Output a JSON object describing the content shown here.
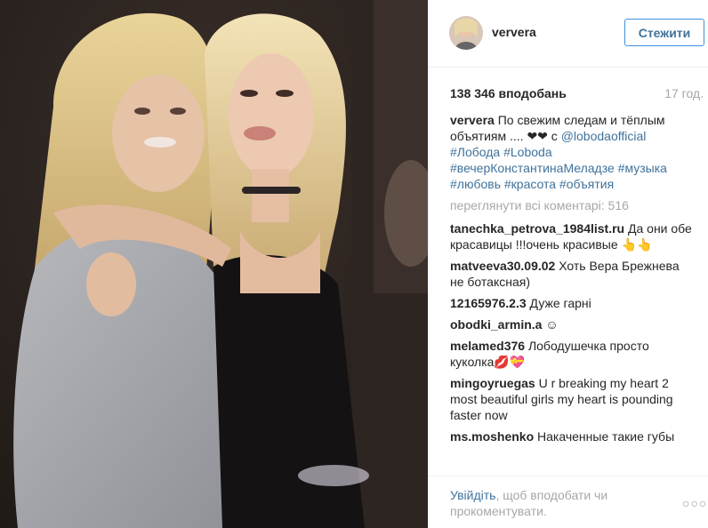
{
  "post": {
    "username": "ververa",
    "follow_label": "Стежити",
    "likes": "138 346 вподобань",
    "time": "17 год.",
    "more_comments": "переглянути всі коментарі: 516"
  },
  "caption": {
    "user": "ververa",
    "text_before": "По свежим следам и тёплым объятиям .... ❤❤ с",
    "mention": "@lobodaofficial",
    "hashtags": "#Лобода #Loboda #вечерКонстантинаМеладзе #музыка #любовь #красота #объятия"
  },
  "comments": [
    {
      "user": "tanechka_petrova_1984list.ru",
      "text": "Да они обе красавицы !!!очень красивые 👆👆"
    },
    {
      "user": "matveeva30.09.02",
      "text": "Хоть Вера Брежнева не ботаксная)"
    },
    {
      "user": "12165976.2.3",
      "text": "Дуже гарні"
    },
    {
      "user": "obodki_armin.a",
      "text": "☺"
    },
    {
      "user": "melamed376",
      "text": "Лободушечка просто куколка💋💝"
    },
    {
      "user": "mingoyruegas",
      "text": "U r breaking my heart 2 most beautiful girls my heart is pounding faster now"
    },
    {
      "user": "ms.moshenko",
      "text": "Накаченные такие губы"
    }
  ],
  "footer": {
    "login_link": "Увійдіть",
    "login_rest": ", щоб вподобати чи прокоментувати.",
    "more_icon": "more-options-icon"
  }
}
